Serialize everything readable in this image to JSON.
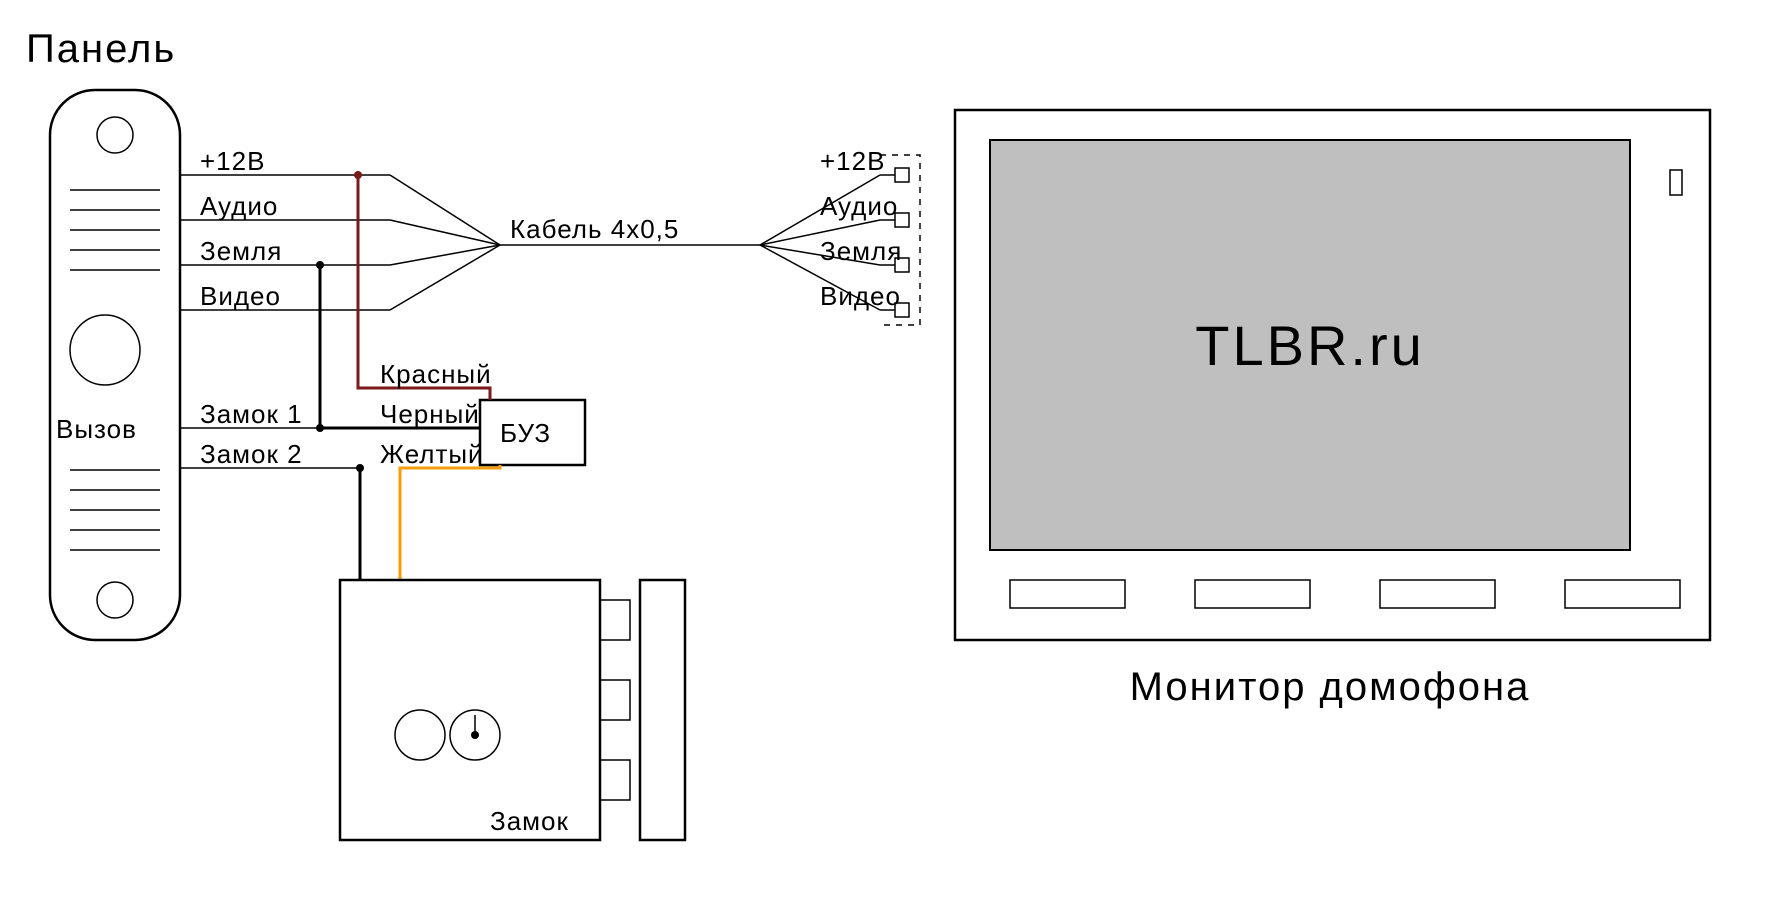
{
  "panel": {
    "title": "Панель",
    "call": "Вызов",
    "signals": {
      "power": "+12В",
      "audio": "Аудио",
      "ground": "Земля",
      "video": "Видео",
      "lock1": "Замок 1",
      "lock2": "Замок 2"
    }
  },
  "buz": {
    "label": "БУЗ",
    "wires": {
      "red": "Красный",
      "black": "Черный",
      "yellow": "Желтый"
    }
  },
  "cable": "Кабель 4х0,5",
  "monitor": {
    "title": "Монитор домофона",
    "screen": "TLBR.ru",
    "signals": {
      "power": "+12В",
      "audio": "Аудио",
      "ground": "Земля",
      "video": "Видео"
    }
  },
  "lock": {
    "label": "Замок"
  }
}
